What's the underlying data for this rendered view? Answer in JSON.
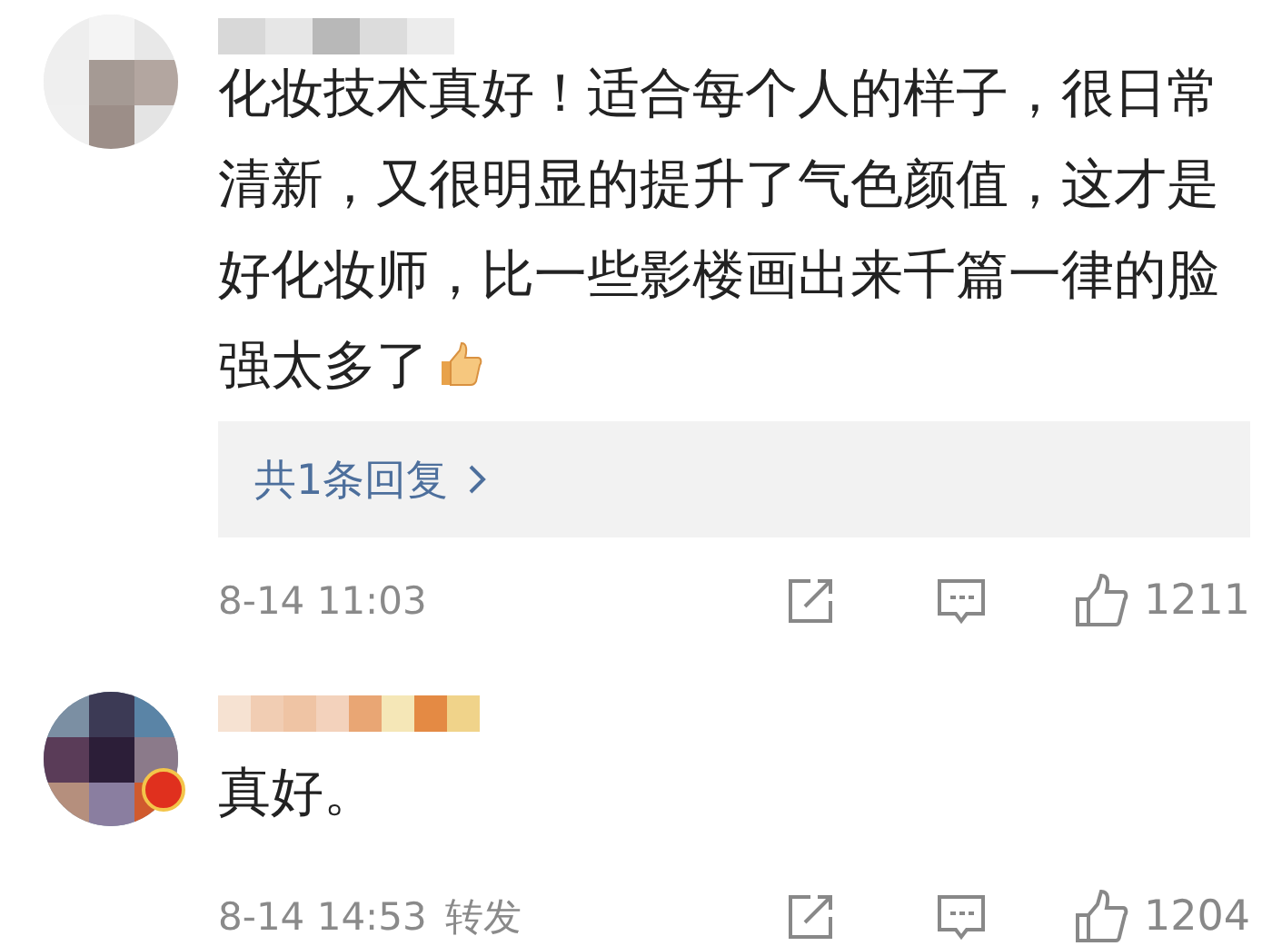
{
  "comments": [
    {
      "badge": false,
      "text": "化妆技术真好！适合每个人的样子，很日常清新，又很明显的提升了气色颜值，这才是好化妆师，比一些影楼画出来千篇一律的脸强太多了",
      "emoji": true,
      "replies_link": "共1条回复",
      "time": "8-14 11:03",
      "likes": "1211"
    },
    {
      "badge": true,
      "text": "真好。",
      "emoji": false,
      "time": "8-14 14:53",
      "repost_label": "转发",
      "likes": "1204"
    }
  ]
}
